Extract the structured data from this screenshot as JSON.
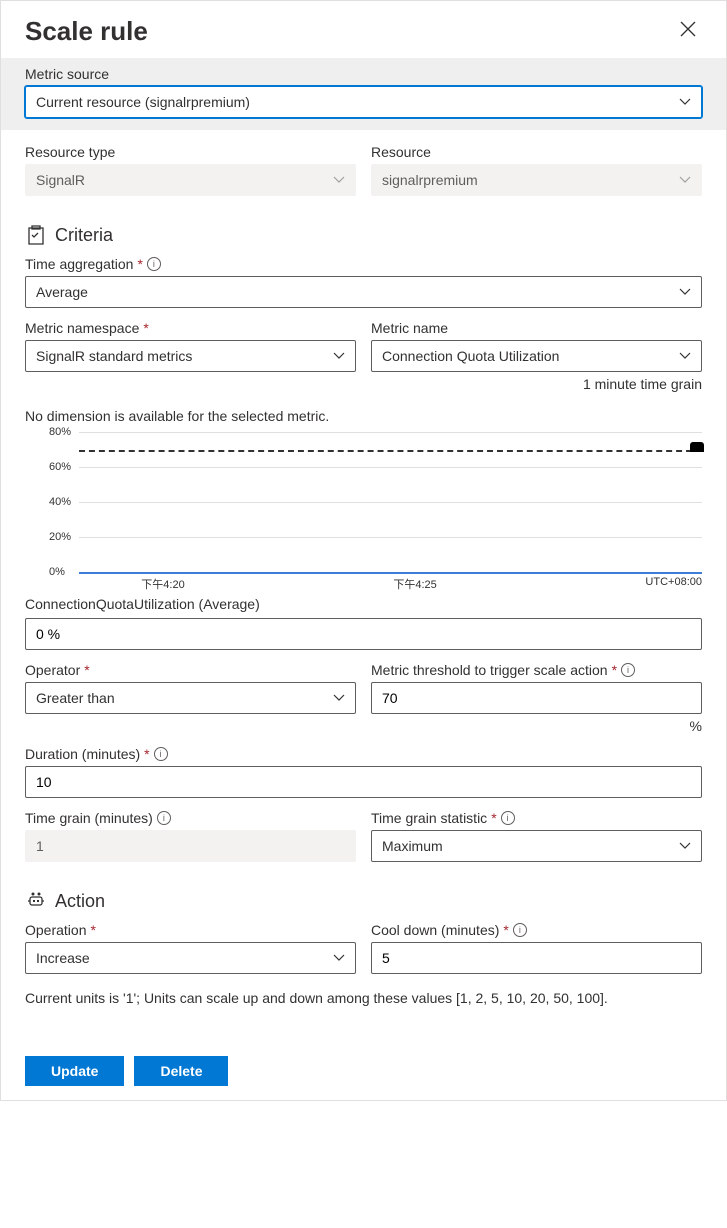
{
  "header": {
    "title": "Scale rule"
  },
  "banner": {
    "metric_source_label": "Metric source",
    "metric_source_value": "Current resource (signalrpremium)"
  },
  "resource": {
    "type_label": "Resource type",
    "type_value": "SignalR",
    "name_label": "Resource",
    "name_value": "signalrpremium"
  },
  "criteria": {
    "heading": "Criteria",
    "time_agg_label": "Time aggregation",
    "time_agg_value": "Average",
    "metric_ns_label": "Metric namespace",
    "metric_ns_value": "SignalR standard metrics",
    "metric_name_label": "Metric name",
    "metric_name_value": "Connection Quota Utilization",
    "time_grain_hint": "1 minute time grain",
    "no_dim_msg": "No dimension is available for the selected metric.",
    "chart_caption": "ConnectionQuotaUtilization (Average)",
    "chart_value": "0 %",
    "operator_label": "Operator",
    "operator_value": "Greater than",
    "threshold_label": "Metric threshold to trigger scale action",
    "threshold_value": "70",
    "threshold_unit": "%",
    "duration_label": "Duration (minutes)",
    "duration_value": "10",
    "timegrain_label": "Time grain (minutes)",
    "timegrain_value": "1",
    "timegrain_stat_label": "Time grain statistic",
    "timegrain_stat_value": "Maximum"
  },
  "action": {
    "heading": "Action",
    "operation_label": "Operation",
    "operation_value": "Increase",
    "cooldown_label": "Cool down (minutes)",
    "cooldown_value": "5",
    "units_msg": "Current units is '1'; Units can scale up and down among these values [1, 2, 5, 10, 20, 50, 100]."
  },
  "footer": {
    "update": "Update",
    "delete": "Delete"
  },
  "chart_data": {
    "type": "line",
    "x_ticks": [
      "下午4:20",
      "下午4:25"
    ],
    "tz": "UTC+08:00",
    "y_ticks": [
      "0%",
      "20%",
      "40%",
      "60%",
      "80%"
    ],
    "ylim": [
      0,
      80
    ],
    "threshold": 70,
    "series": [
      {
        "name": "ConnectionQuotaUtilization (Average)",
        "value": 0
      }
    ]
  }
}
